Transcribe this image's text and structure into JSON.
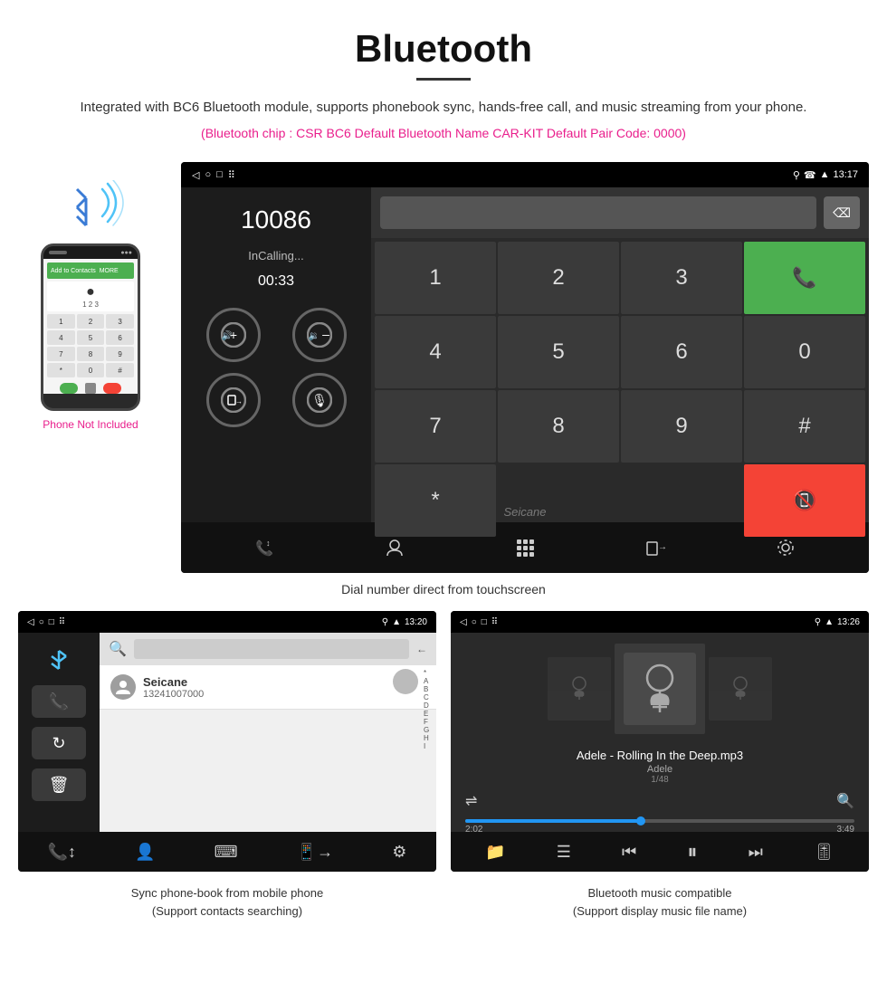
{
  "header": {
    "title": "Bluetooth",
    "description": "Integrated with BC6 Bluetooth module, supports phonebook sync, hands-free call, and music streaming from your phone.",
    "specs": "(Bluetooth chip : CSR BC6    Default Bluetooth Name CAR-KIT    Default Pair Code: 0000)"
  },
  "phone_mockup": {
    "not_included_label": "Phone Not Included"
  },
  "dial_screen": {
    "status_time": "13:17",
    "number": "10086",
    "status": "InCalling...",
    "timer": "00:33",
    "keys": [
      "1",
      "2",
      "3",
      "*",
      "4",
      "5",
      "6",
      "0",
      "7",
      "8",
      "9",
      "#"
    ],
    "watermark": "Seicane"
  },
  "dial_caption": "Dial number direct from touchscreen",
  "phonebook_screen": {
    "status_time": "13:20",
    "contact_name": "Seicane",
    "contact_phone": "13241007000",
    "alpha_letters": [
      "*",
      "A",
      "B",
      "C",
      "D",
      "E",
      "F",
      "G",
      "H",
      "I"
    ]
  },
  "phonebook_caption_line1": "Sync phone-book from mobile phone",
  "phonebook_caption_line2": "(Support contacts searching)",
  "music_screen": {
    "status_time": "13:26",
    "song_title": "Adele - Rolling In the Deep.mp3",
    "artist": "Adele",
    "track_position": "1/48",
    "time_current": "2:02",
    "time_total": "3:49"
  },
  "music_caption_line1": "Bluetooth music compatible",
  "music_caption_line2": "(Support display music file name)"
}
